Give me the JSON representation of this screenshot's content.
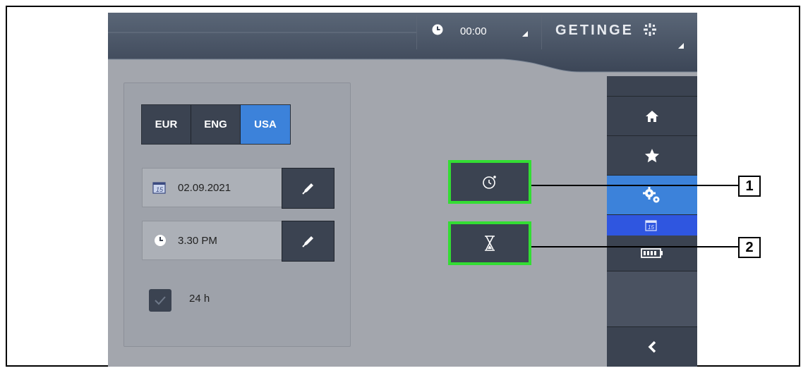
{
  "header": {
    "clock_time": "00:00",
    "brand": "GETINGE"
  },
  "units": {
    "options": [
      "EUR",
      "ENG",
      "USA"
    ],
    "selected": "USA"
  },
  "date_field": {
    "value": "02.09.2021",
    "icon": "calendar-icon"
  },
  "time_field": {
    "value": "3.30 PM",
    "icon": "clock-icon"
  },
  "format_24h": {
    "label": "24 h",
    "checked": true
  },
  "function_buttons": [
    {
      "name": "stopwatch",
      "icon": "stopwatch-icon"
    },
    {
      "name": "timer",
      "icon": "hourglass-icon"
    }
  ],
  "sidebar": {
    "items": [
      "home-icon",
      "star-icon",
      "settings-icon",
      "calendar-icon",
      "battery-icon",
      "back-icon"
    ],
    "active": "settings-icon"
  },
  "callouts": [
    "1",
    "2"
  ],
  "colors": {
    "accent": "#3c82da",
    "highlight_green": "#33dd33",
    "dark_panel": "#3b4351",
    "screen_bg": "#a3a6ad"
  }
}
